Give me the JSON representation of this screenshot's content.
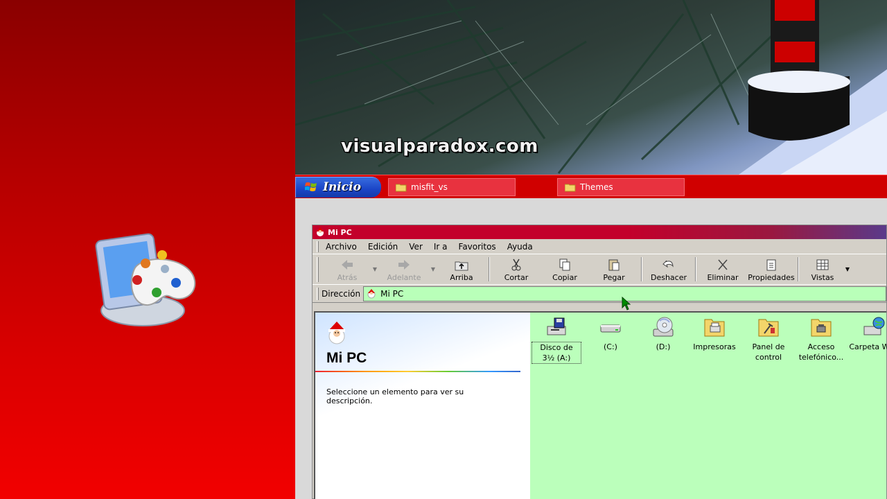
{
  "wallpaper": {
    "watermark": "visualparadox.com"
  },
  "taskbar": {
    "start_label": "Inicio",
    "tasks": [
      {
        "label": "misfit_vs"
      },
      {
        "label": "Themes"
      }
    ]
  },
  "window": {
    "title": "Mi PC",
    "menu": [
      "Archivo",
      "Edición",
      "Ver",
      "Ir a",
      "Favoritos",
      "Ayuda"
    ],
    "toolbar": {
      "back": "Atrás",
      "forward": "Adelante",
      "up": "Arriba",
      "cut": "Cortar",
      "copy": "Copiar",
      "paste": "Pegar",
      "undo": "Deshacer",
      "delete": "Eliminar",
      "properties": "Propiedades",
      "views": "Vistas"
    },
    "address": {
      "label": "Dirección",
      "value": "Mi PC"
    },
    "webview": {
      "title": "Mi PC",
      "description": "Seleccione un elemento para ver su descripción."
    },
    "items": [
      {
        "label": "Disco de 3½ (A:)",
        "icon": "floppy-drive-icon"
      },
      {
        "label": "(C:)",
        "icon": "hard-drive-icon"
      },
      {
        "label": "(D:)",
        "icon": "cd-drive-icon"
      },
      {
        "label": "Impresoras",
        "icon": "printers-folder-icon"
      },
      {
        "label": "Panel de control",
        "icon": "control-panel-folder-icon"
      },
      {
        "label": "Acceso telefónico...",
        "icon": "dialup-folder-icon"
      },
      {
        "label": "Carpeta Web",
        "icon": "web-folder-icon"
      }
    ]
  },
  "colors": {
    "left_panel": "#b50000",
    "taskbar": "#d00000",
    "content_bg": "#bbffbb",
    "address_bg": "#b9ffb9"
  }
}
